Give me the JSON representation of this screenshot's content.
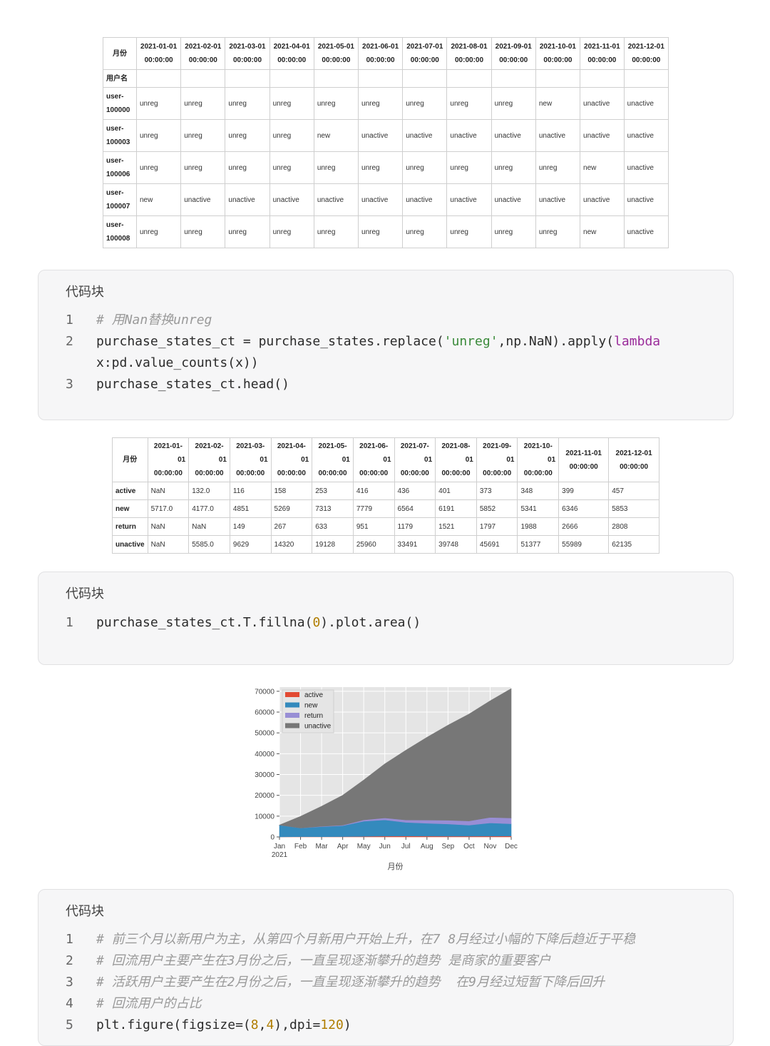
{
  "table1": {
    "corner_label": "月份",
    "index_label": "用户名",
    "columns": [
      [
        "2021-01-01",
        "00:00:00"
      ],
      [
        "2021-02-01",
        "00:00:00"
      ],
      [
        "2021-03-01",
        "00:00:00"
      ],
      [
        "2021-04-01",
        "00:00:00"
      ],
      [
        "2021-05-01",
        "00:00:00"
      ],
      [
        "2021-06-01",
        "00:00:00"
      ],
      [
        "2021-07-01",
        "00:00:00"
      ],
      [
        "2021-08-01",
        "00:00:00"
      ],
      [
        "2021-09-01",
        "00:00:00"
      ],
      [
        "2021-10-01",
        "00:00:00"
      ],
      [
        "2021-11-01",
        "00:00:00"
      ],
      [
        "2021-12-01",
        "00:00:00"
      ]
    ],
    "rows": [
      {
        "index": [
          "user-",
          "100000"
        ],
        "cells": [
          "unreg",
          "unreg",
          "unreg",
          "unreg",
          "unreg",
          "unreg",
          "unreg",
          "unreg",
          "unreg",
          "new",
          "unactive",
          "unactive"
        ]
      },
      {
        "index": [
          "user-",
          "100003"
        ],
        "cells": [
          "unreg",
          "unreg",
          "unreg",
          "unreg",
          "new",
          "unactive",
          "unactive",
          "unactive",
          "unactive",
          "unactive",
          "unactive",
          "unactive"
        ]
      },
      {
        "index": [
          "user-",
          "100006"
        ],
        "cells": [
          "unreg",
          "unreg",
          "unreg",
          "unreg",
          "unreg",
          "unreg",
          "unreg",
          "unreg",
          "unreg",
          "unreg",
          "new",
          "unactive"
        ]
      },
      {
        "index": [
          "user-",
          "100007"
        ],
        "cells": [
          "new",
          "unactive",
          "unactive",
          "unactive",
          "unactive",
          "unactive",
          "unactive",
          "unactive",
          "unactive",
          "unactive",
          "unactive",
          "unactive"
        ]
      },
      {
        "index": [
          "user-",
          "100008"
        ],
        "cells": [
          "unreg",
          "unreg",
          "unreg",
          "unreg",
          "unreg",
          "unreg",
          "unreg",
          "unreg",
          "unreg",
          "unreg",
          "new",
          "unactive"
        ]
      }
    ]
  },
  "code1": {
    "title": "代码块",
    "lines": [
      {
        "n": "1",
        "text": "# 用Nan替换unreg"
      },
      {
        "n": "2",
        "a": "purchase_states_ct = purchase_states.replace(",
        "s": "'unreg'",
        "b": ",np.NaN).apply(",
        "k": "lambda",
        "c": "x:pd.value_counts(x))"
      },
      {
        "n": "3",
        "text": "purchase_states_ct.head()"
      }
    ]
  },
  "table2": {
    "corner_label": "月份",
    "columns": [
      [
        "2021-01-",
        "01",
        "00:00:00"
      ],
      [
        "2021-02-",
        "01",
        "00:00:00"
      ],
      [
        "2021-03-",
        "01",
        "00:00:00"
      ],
      [
        "2021-04-",
        "01",
        "00:00:00"
      ],
      [
        "2021-05-",
        "01",
        "00:00:00"
      ],
      [
        "2021-06-",
        "01",
        "00:00:00"
      ],
      [
        "2021-07-",
        "01",
        "00:00:00"
      ],
      [
        "2021-08-",
        "01",
        "00:00:00"
      ],
      [
        "2021-09-",
        "01",
        "00:00:00"
      ],
      [
        "2021-10-",
        "01",
        "00:00:00"
      ],
      [
        "2021-11-01",
        "00:00:00"
      ],
      [
        "2021-12-01",
        "00:00:00"
      ]
    ],
    "rows": [
      {
        "index": "active",
        "cells": [
          "NaN",
          "132.0",
          "116",
          "158",
          "253",
          "416",
          "436",
          "401",
          "373",
          "348",
          "399",
          "457"
        ]
      },
      {
        "index": "new",
        "cells": [
          "5717.0",
          "4177.0",
          "4851",
          "5269",
          "7313",
          "7779",
          "6564",
          "6191",
          "5852",
          "5341",
          "6346",
          "5853"
        ]
      },
      {
        "index": "return",
        "cells": [
          "NaN",
          "NaN",
          "149",
          "267",
          "633",
          "951",
          "1179",
          "1521",
          "1797",
          "1988",
          "2666",
          "2808"
        ]
      },
      {
        "index": "unactive",
        "cells": [
          "NaN",
          "5585.0",
          "9629",
          "14320",
          "19128",
          "25960",
          "33491",
          "39748",
          "45691",
          "51377",
          "55989",
          "62135"
        ]
      }
    ]
  },
  "code2": {
    "title": "代码块",
    "n": "1",
    "a": "purchase_states_ct.T.fillna(",
    "num": "0",
    "b": ").plot.area()"
  },
  "chart_data": {
    "type": "area",
    "stacked": true,
    "x": [
      "Jan\n2021",
      "Feb",
      "Mar",
      "Apr",
      "May",
      "Jun",
      "Jul",
      "Aug",
      "Sep",
      "Oct",
      "Nov",
      "Dec"
    ],
    "xlabel": "月份",
    "ylim": [
      0,
      72000
    ],
    "yticks": [
      0,
      10000,
      20000,
      30000,
      40000,
      50000,
      60000,
      70000
    ],
    "grid": true,
    "legend": "top-left",
    "series": [
      {
        "name": "active",
        "color": "#e24a33",
        "values": [
          0,
          132,
          116,
          158,
          253,
          416,
          436,
          401,
          373,
          348,
          399,
          457
        ]
      },
      {
        "name": "new",
        "color": "#348abd",
        "values": [
          5717,
          4177,
          4851,
          5269,
          7313,
          7779,
          6564,
          6191,
          5852,
          5341,
          6346,
          5853
        ]
      },
      {
        "name": "return",
        "color": "#988ed5",
        "values": [
          0,
          0,
          149,
          267,
          633,
          951,
          1179,
          1521,
          1797,
          1988,
          2666,
          2808
        ]
      },
      {
        "name": "unactive",
        "color": "#777777",
        "values": [
          0,
          5585,
          9629,
          14320,
          19128,
          25960,
          33491,
          39748,
          45691,
          51377,
          55989,
          62135
        ]
      }
    ]
  },
  "code3": {
    "title": "代码块",
    "lines": [
      {
        "n": "1",
        "text": "# 前三个月以新用户为主，从第四个月新用户开始上升，在7 8月经过小幅的下降后趋近于平稳",
        "cmt": true
      },
      {
        "n": "2",
        "text": "# 回流用户主要产生在3月份之后，一直呈现逐渐攀升的趋势 是商家的重要客户",
        "cmt": true
      },
      {
        "n": "3",
        "text": "# 活跃用户主要产生在2月份之后，一直呈现逐渐攀升的趋势  在9月经过短暂下降后回升",
        "cmt": true
      },
      {
        "n": "4",
        "text": "# 回流用户的占比",
        "cmt": true
      },
      {
        "n": "5",
        "a": "plt.figure(figsize=(",
        "n1": "8",
        "m": ",",
        "n2": "4",
        "b": "),dpi=",
        "n3": "120",
        "c": ")"
      }
    ]
  }
}
